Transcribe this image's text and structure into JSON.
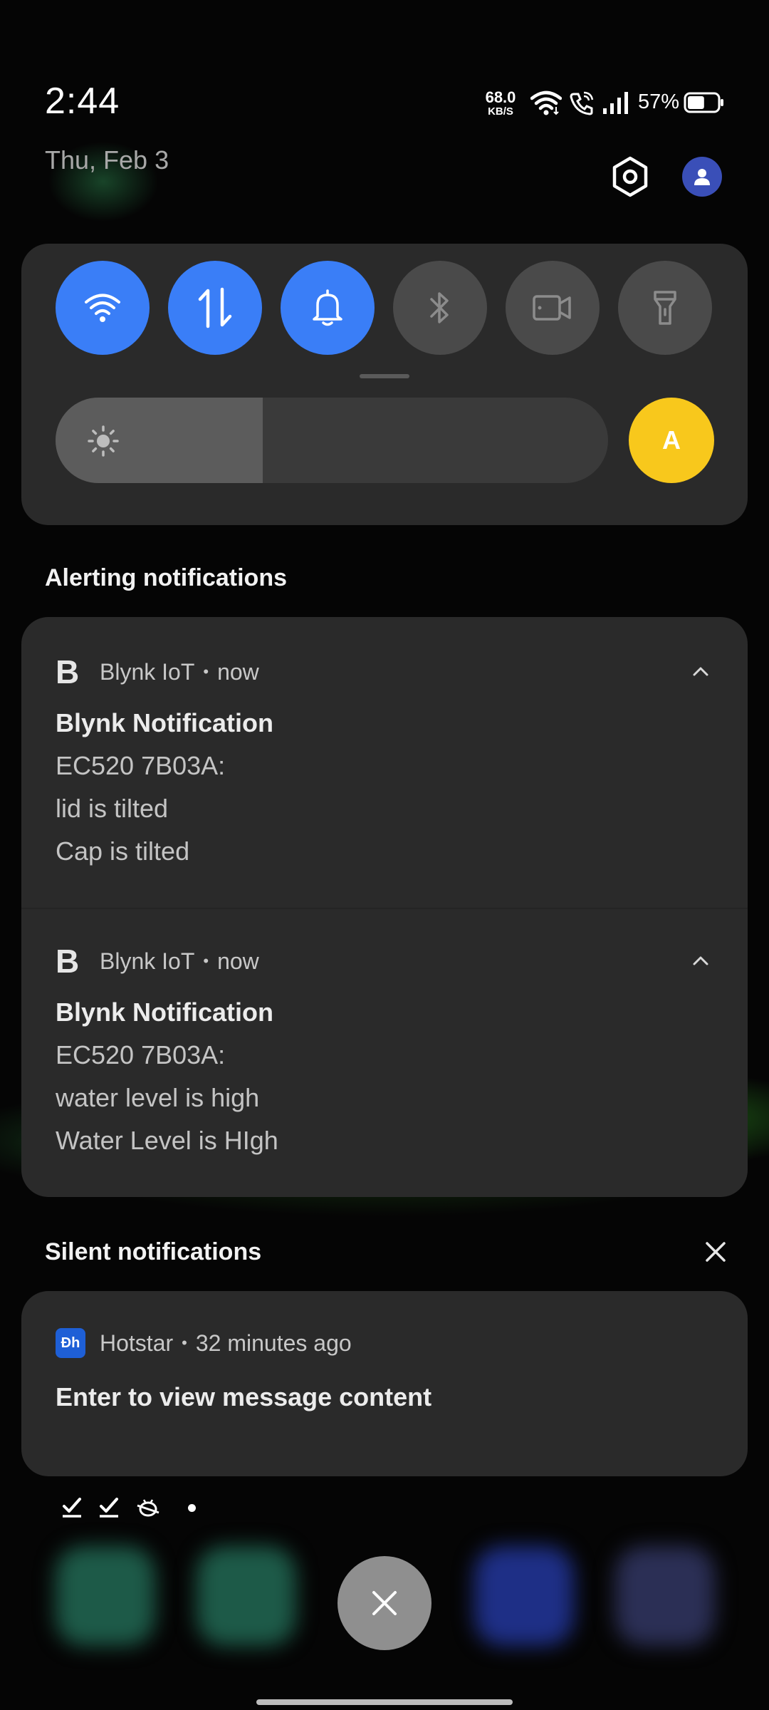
{
  "status_bar": {
    "time": "2:44",
    "date": "Thu, Feb 3",
    "net_speed_value": "68.0",
    "net_speed_unit": "KB/S",
    "battery_percent": "57%",
    "battery_level": 0.57,
    "icons": [
      "wifi-icon",
      "wifi-calling-icon",
      "signal-icon",
      "battery-icon"
    ]
  },
  "header_actions": {
    "settings_icon": "settings-hexagon-icon",
    "user_icon": "user-avatar-icon"
  },
  "quick_settings": {
    "tiles": [
      {
        "name": "wifi",
        "icon": "wifi-icon",
        "state": "on"
      },
      {
        "name": "mobile-data",
        "icon": "data-transfer-icon",
        "state": "on"
      },
      {
        "name": "sound",
        "icon": "bell-icon",
        "state": "on"
      },
      {
        "name": "bluetooth",
        "icon": "bluetooth-icon",
        "state": "off"
      },
      {
        "name": "screen-recorder",
        "icon": "video-camera-icon",
        "state": "off"
      },
      {
        "name": "flashlight",
        "icon": "flashlight-icon",
        "state": "off"
      }
    ],
    "brightness_level": 0.375,
    "auto_brightness_label": "A"
  },
  "alerting": {
    "title": "Alerting notifications",
    "notifications": [
      {
        "app_letter": "B",
        "app_name": "Blynk IoT",
        "time": "now",
        "title": "Blynk Notification",
        "lines": [
          "EC520 7B03A:",
          "lid is tilted",
          "Cap is tilted"
        ]
      },
      {
        "app_letter": "B",
        "app_name": "Blynk IoT",
        "time": "now",
        "title": "Blynk Notification",
        "lines": [
          "EC520 7B03A:",
          "water level is high",
          "Water Level is HIgh"
        ]
      }
    ]
  },
  "silent": {
    "title": "Silent notifications",
    "notifications": [
      {
        "app_icon_text": "Ɖh",
        "app_name": "Hotstar",
        "time": "32 minutes ago",
        "title": "Enter to view message content"
      }
    ]
  },
  "status_icons_row": [
    "check-icon",
    "check-icon",
    "bug-icon",
    "dot-icon"
  ],
  "colors": {
    "accent": "#3a7ef7",
    "auto_brightness": "#f8c81c",
    "panel": "#2a2a2a",
    "tile_off": "#4a4a4a"
  }
}
